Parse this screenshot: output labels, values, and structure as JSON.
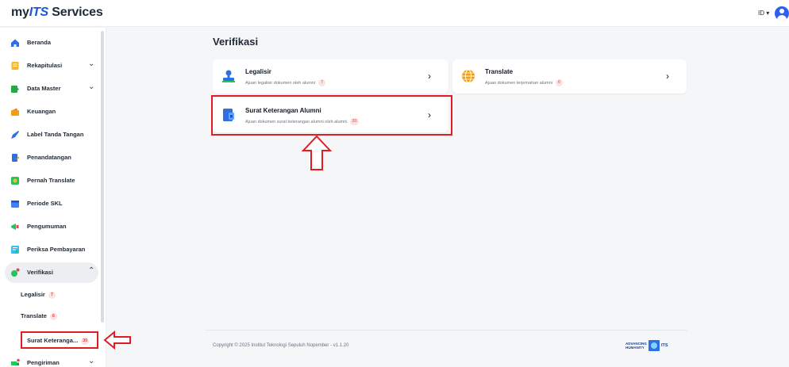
{
  "header": {
    "logo_prefix": "my",
    "logo_brand": "ITS",
    "logo_suffix": " Services",
    "language": "ID ▾"
  },
  "sidebar": {
    "items": [
      {
        "label": "Beranda",
        "icon": "home-icon",
        "expandable": false
      },
      {
        "label": "Rekapitulasi",
        "icon": "document-icon",
        "expandable": true
      },
      {
        "label": "Data Master",
        "icon": "folder-icon",
        "expandable": true
      },
      {
        "label": "Keuangan",
        "icon": "wallet-icon",
        "expandable": false
      },
      {
        "label": "Label Tanda Tangan",
        "icon": "pen-icon",
        "expandable": false
      },
      {
        "label": "Penandatangan",
        "icon": "signer-icon",
        "expandable": false
      },
      {
        "label": "Pernah Translate",
        "icon": "translate-icon",
        "expandable": false
      },
      {
        "label": "Periode SKL",
        "icon": "calendar-icon",
        "expandable": false
      },
      {
        "label": "Pengumuman",
        "icon": "megaphone-icon",
        "expandable": false
      },
      {
        "label": "Periksa Pembayaran",
        "icon": "receipt-icon",
        "expandable": false
      },
      {
        "label": "Verifikasi",
        "icon": "verify-icon",
        "expandable": true,
        "expanded": true,
        "active": true
      },
      {
        "label": "Pengiriman",
        "icon": "truck-icon",
        "expandable": true
      }
    ],
    "sub_items": [
      {
        "label": "Legalisir",
        "badge": "7"
      },
      {
        "label": "Translate",
        "badge": "6"
      },
      {
        "label": "Surat Keterangа...",
        "badge": "30",
        "highlighted": true
      }
    ]
  },
  "main": {
    "title": "Verifikasi",
    "cards": [
      {
        "title": "Legalisir",
        "subtitle": "Ajuan legalisir dokumen oleh alumni",
        "badge": "7",
        "icon": "stamp-icon"
      },
      {
        "title": "Translate",
        "subtitle": "Ajuan dokumen terjemahan alumni",
        "badge": "6",
        "icon": "globe-icon"
      },
      {
        "title": "Surat Keterangan Alumni",
        "subtitle": "Ajuan dokumen surat keterangan alumni oleh alumni",
        "badge": "30",
        "icon": "certificate-icon",
        "highlighted": true
      }
    ],
    "chevron": "›"
  },
  "footer": {
    "copyright": "Copyright © 2025 Institut Teknologi Sepuluh Nopember - v1.1.20",
    "logo_text_1": "ADVANCING",
    "logo_text_2": "HUMANITY",
    "logo_its": "ITS"
  },
  "colors": {
    "brand": "#1c55d6",
    "highlight": "#e11d24",
    "badge_bg": "#fde2e2",
    "badge_text": "#ef4444"
  }
}
